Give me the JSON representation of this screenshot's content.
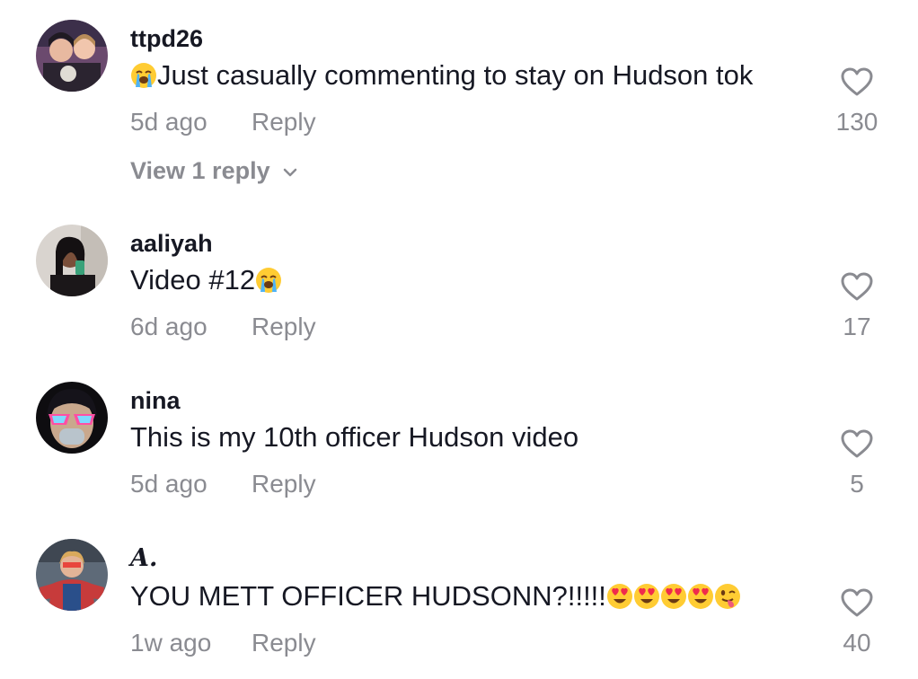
{
  "comments": [
    {
      "username": "ttpd26",
      "prefix_emoji": "loudly-crying-face",
      "text": "Just casually commenting to stay on Hudson tok",
      "suffix_emojis": [],
      "time": "5d ago",
      "reply_label": "Reply",
      "likes": "130",
      "view_replies": "View 1 reply"
    },
    {
      "username": "aaliyah",
      "text": "Video #12",
      "suffix_emojis": [
        "loudly-crying-face"
      ],
      "time": "6d ago",
      "reply_label": "Reply",
      "likes": "17"
    },
    {
      "username": "nina",
      "text": "This is my 10th officer Hudson video",
      "suffix_emojis": [],
      "time": "5d ago",
      "reply_label": "Reply",
      "likes": "5"
    },
    {
      "username": "𝑨.",
      "text": "YOU METT OFFICER HUDSONN?!!!!!",
      "suffix_emojis": [
        "heart-eyes-face",
        "heart-eyes-face",
        "heart-eyes-face",
        "heart-eyes-face",
        "winking-tongue-face"
      ],
      "time": "1w ago",
      "reply_label": "Reply",
      "likes": "40"
    }
  ],
  "colors": {
    "text_primary": "#161823",
    "text_secondary": "#8a8b91",
    "background": "#ffffff"
  }
}
